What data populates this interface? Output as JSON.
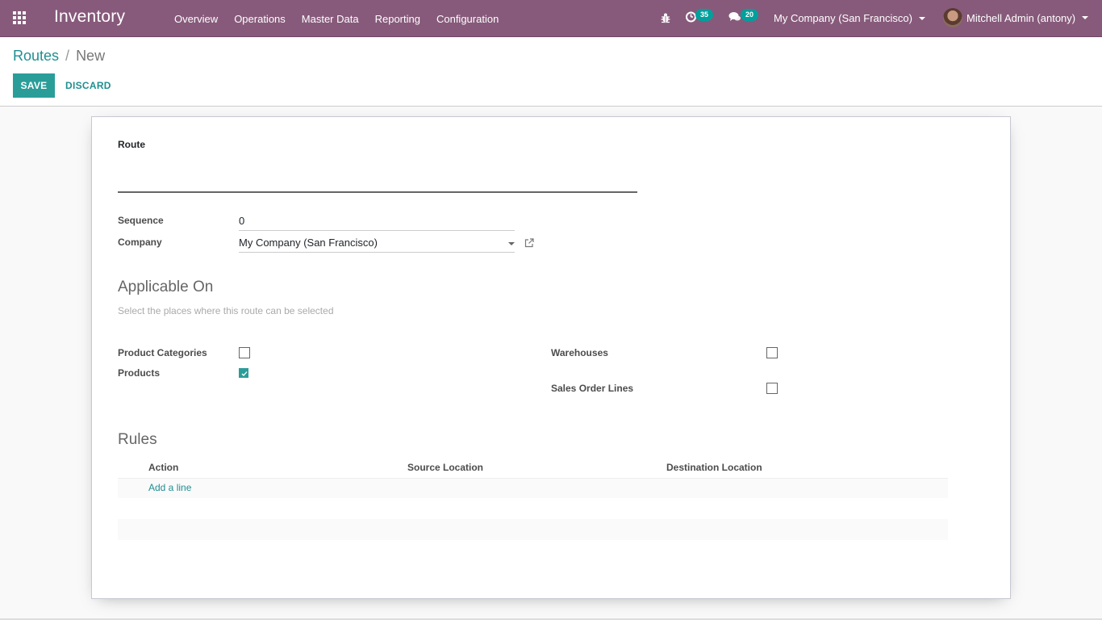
{
  "navbar": {
    "app_name": "Inventory",
    "menu": [
      "Overview",
      "Operations",
      "Master Data",
      "Reporting",
      "Configuration"
    ],
    "activity_count": "35",
    "messages_count": "20",
    "company": "My Company (San Francisco)",
    "user": "Mitchell Admin (antony)",
    "colors": {
      "navbar_bg": "#875a7b",
      "badge_bg": "#00a09d"
    }
  },
  "control_panel": {
    "breadcrumb": {
      "parent": "Routes",
      "separator": "/",
      "current": "New"
    },
    "save_label": "SAVE",
    "discard_label": "DISCARD",
    "colors": {
      "primary": "#2a9d99"
    }
  },
  "form": {
    "route_label": "Route",
    "route_value": "",
    "sequence_label": "Sequence",
    "sequence_value": "0",
    "company_label": "Company",
    "company_value": "My Company (San Francisco)",
    "applicable_title": "Applicable On",
    "applicable_help": "Select the places where this route can be selected",
    "applicable": {
      "product_categories": {
        "label": "Product Categories",
        "checked": false
      },
      "products": {
        "label": "Products",
        "checked": true
      },
      "warehouses": {
        "label": "Warehouses",
        "checked": false
      },
      "sales_order_lines": {
        "label": "Sales Order Lines",
        "checked": false
      }
    },
    "rules_title": "Rules",
    "rules_columns": [
      "Action",
      "Source Location",
      "Destination Location"
    ],
    "rules_rows": [],
    "add_line_label": "Add a line"
  }
}
